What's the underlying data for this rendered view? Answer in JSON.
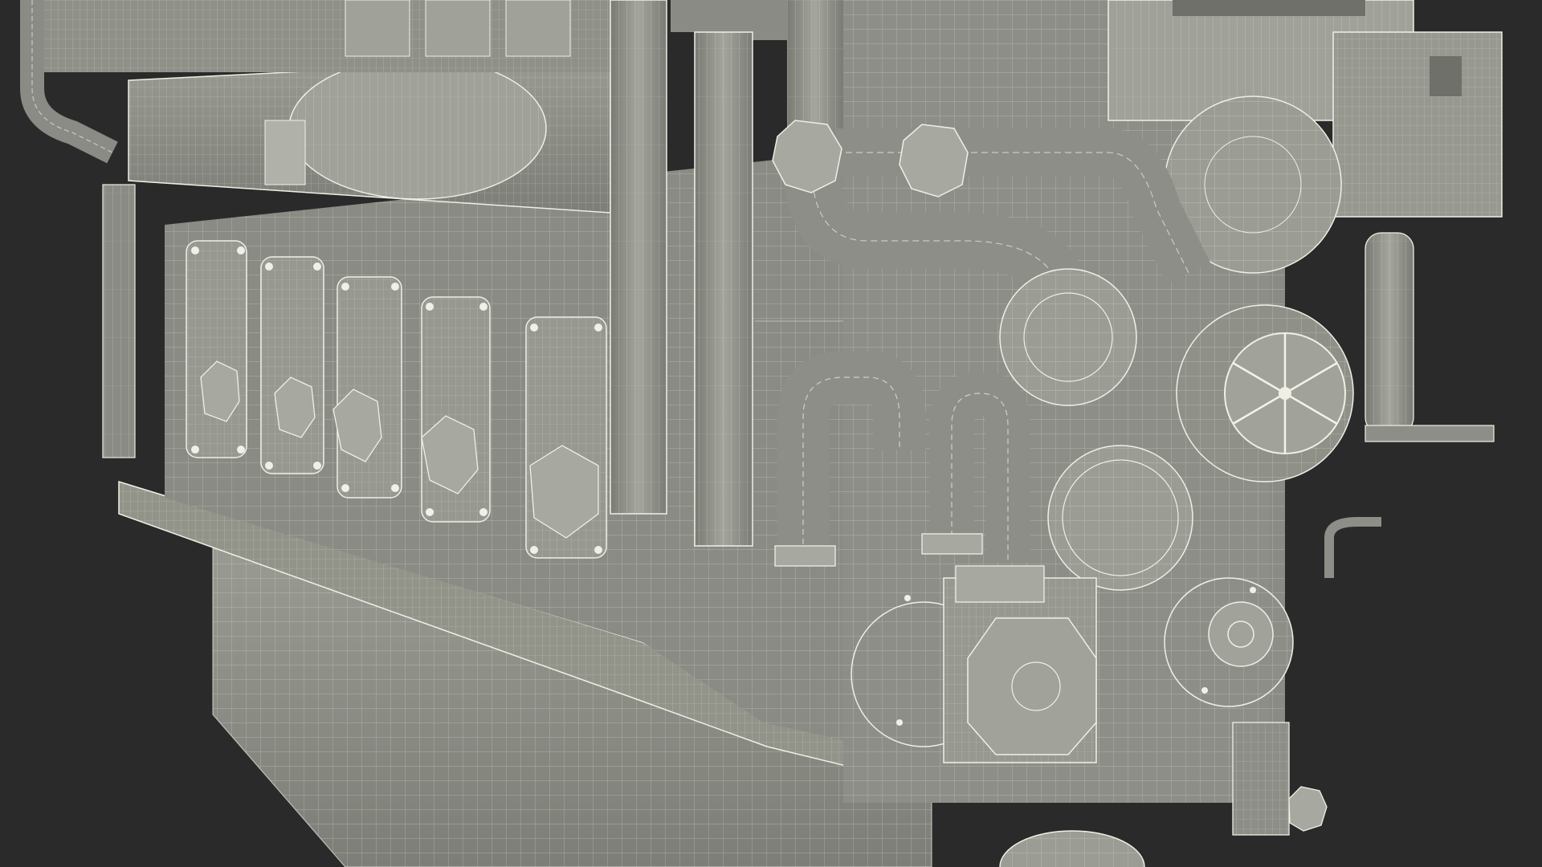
{
  "scene": {
    "subject": "engine-wireframe-render",
    "colors": {
      "background": "#2a2a2a",
      "surface": "#8f9088",
      "surface_light": "#a3a49c",
      "surface_dark": "#6f706a",
      "wire": "#e6e6de"
    }
  }
}
